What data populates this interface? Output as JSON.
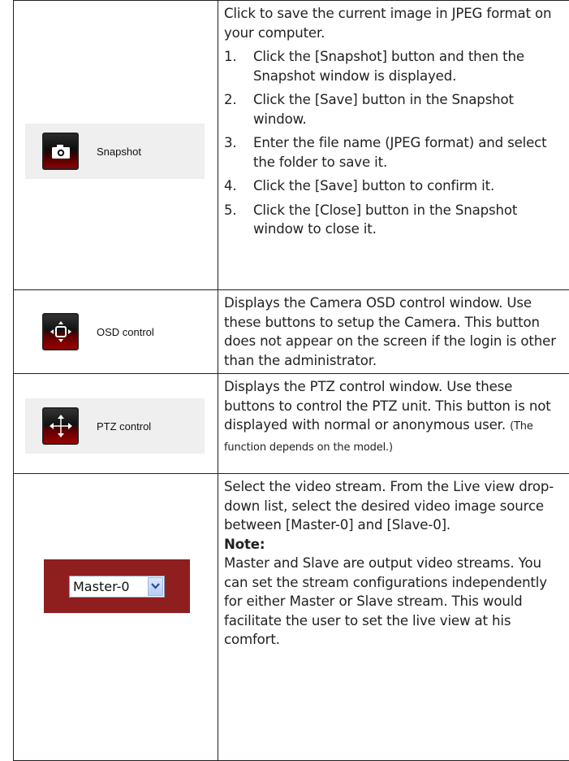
{
  "rows": {
    "snapshot": {
      "button_label": "Snapshot",
      "intro": "Click to save the current image in JPEG format on your computer.",
      "steps": [
        {
          "num": "1.",
          "text": "Click the [Snapshot] button and then the Snapshot window is displayed."
        },
        {
          "num": "2.",
          "text": "Click the [Save] button in the Snapshot window."
        },
        {
          "num": "3.",
          "text": "Enter the file name (JPEG format) and select the folder to save it."
        },
        {
          "num": "4.",
          "text": "Click the [Save] button to confirm it."
        },
        {
          "num": "5.",
          "text": "Click the [Close] button in the Snapshot window to close it."
        }
      ]
    },
    "osd": {
      "button_label": "OSD control",
      "text": "Displays the Camera OSD control window. Use these buttons to setup the Camera. This button does not appear on the screen if the login is other than the administrator."
    },
    "ptz": {
      "button_label": "PTZ control",
      "text": "Displays the PTZ control window. Use these buttons to control the PTZ unit. This button is not displayed with normal or anonymous user.",
      "small_text": "(The function depends on the model.)"
    },
    "stream": {
      "select_value": "Master-0",
      "text": "Select the video stream. From the Live view drop-down list, select the desired video image source between [Master-0] and [Slave-0].",
      "note_heading": "Note:",
      "note_text": "Master and Slave are output video streams. You can set the stream configurations independently for either Master or Slave stream. This would facilitate the user to set the live view at his comfort."
    }
  },
  "colors": {
    "text": "#231f20",
    "button_red": "#8a0000",
    "dropdown_bg": "#8f1f1f"
  },
  "icons": [
    "camera-icon",
    "osd-control-icon",
    "ptz-arrows-icon",
    "chevron-down-icon"
  ]
}
